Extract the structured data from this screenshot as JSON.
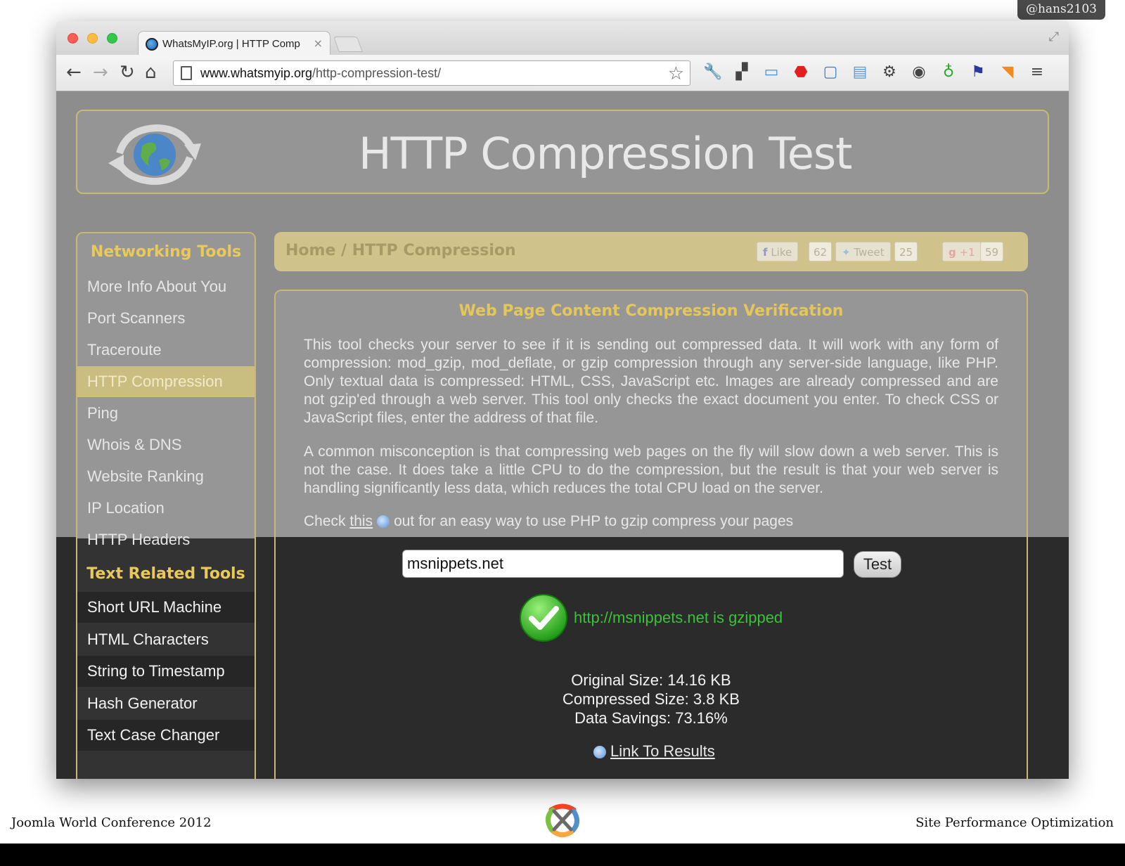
{
  "slide": {
    "handle": "@hans2103",
    "footer_left": "Joomla World Conference 2012",
    "footer_right": "Site Performance Optimization",
    "logo": "joomla-logo"
  },
  "browser": {
    "tab_title": "WhatsMyIP.org | HTTP Comp",
    "tab_close": "×",
    "url_host": "www.whatsmyip.org",
    "url_path": "/http-compression-test/",
    "nav": {
      "back": "←",
      "forward": "→",
      "reload": "↻",
      "home": "⌂"
    },
    "star": "☆",
    "expand": "⤢",
    "extensions": [
      "wrench-icon",
      "qr-icon",
      "cast-icon",
      "adblock-icon",
      "screenshot-icon",
      "window-icon",
      "gear-icon",
      "color-icon",
      "timer-icon",
      "flag-icon",
      "rss-icon",
      "menu-icon"
    ]
  },
  "site": {
    "title": "HTTP Compression Test"
  },
  "sidebar": {
    "networking_heading": "Networking Tools",
    "networking_items": [
      "More Info About You",
      "Port Scanners",
      "Traceroute",
      "HTTP Compression",
      "Ping",
      "Whois & DNS",
      "Website Ranking",
      "IP Location",
      "HTTP Headers"
    ],
    "active_index": 3,
    "text_heading": "Text Related Tools",
    "text_items": [
      "Short URL Machine",
      "HTML Characters",
      "String to Timestamp",
      "Hash Generator",
      "Text Case Changer"
    ]
  },
  "breadcrumb": {
    "text": "Home / HTTP Compression",
    "like_label": "Like",
    "like_count": "62",
    "tweet_label": "Tweet",
    "tweet_count": "25",
    "plusone_label": "+1",
    "plusone_count": "59"
  },
  "content": {
    "heading": "Web Page Content Compression Verification",
    "para1": "This tool checks your server to see if it is sending out compressed data. It will work with any form of compression: mod_gzip, mod_deflate, or gzip compression through any server-side language, like PHP. Only textual data is compressed: HTML, CSS, JavaScript etc. Images are already compressed and are not gzip'ed through a web server. This tool only checks the exact document you enter. To check CSS or JavaScript files, enter the address of that file.",
    "para2": "A common misconception is that compressing web pages on the fly will slow down a web server. This is not the case. It does take a little CPU to do the compression, but the result is that your web server is handling significantly less data, which reduces the total CPU load on the server.",
    "check_prefix": "Check",
    "check_link": "this",
    "check_suffix": "out for an easy way to use PHP to gzip compress your pages",
    "input_value": "msnippets.net",
    "test_label": "Test",
    "result": "http://msnippets.net is gzipped",
    "original_size": "Original Size: 14.16 KB",
    "compressed_size": "Compressed Size: 3.8 KB",
    "data_savings": "Data Savings: 73.16%",
    "results_link": "Link To Results"
  }
}
